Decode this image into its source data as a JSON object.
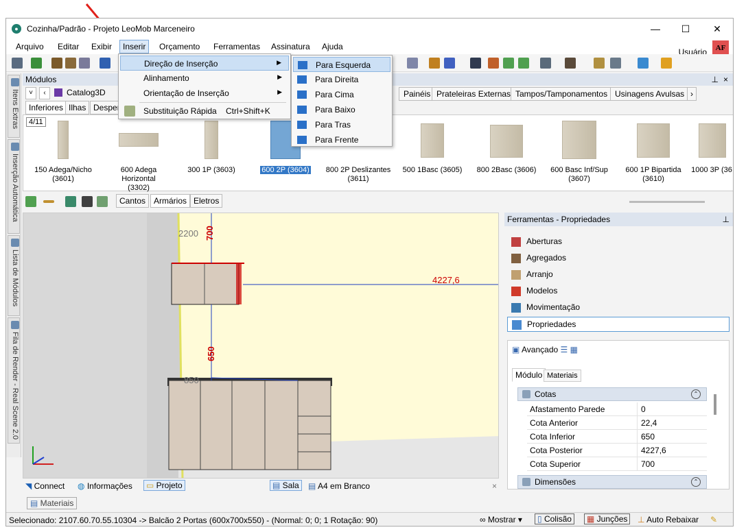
{
  "window": {
    "title": "Cozinha/Padrão - Projeto LeoMob Marceneiro",
    "controls": [
      "—",
      "☐",
      "✕"
    ]
  },
  "menu": {
    "items": [
      "Arquivo",
      "Editar",
      "Exibir",
      "Inserir",
      "Orçamento",
      "Ferramentas",
      "Assinatura",
      "Ajuda"
    ],
    "active": "Inserir"
  },
  "user": {
    "label": "Usuário",
    "avatar": "AF"
  },
  "inserir_menu": {
    "items": [
      {
        "label": "Direção de Inserção",
        "submenu": true
      },
      {
        "label": "Alinhamento",
        "submenu": true
      },
      {
        "label": "Orientação de Inserção",
        "submenu": true
      },
      {
        "label": "Substituição Rápida",
        "shortcut": "Ctrl+Shift+K"
      }
    ]
  },
  "direcao_submenu": {
    "items": [
      "Para Esquerda",
      "Para Direita",
      "Para Cima",
      "Para Baixo",
      "Para Tras",
      "Para Frente"
    ]
  },
  "left_tabs": [
    "Itens Extras",
    "Inserção Automática",
    "Lista de Módulos",
    "Fila de Render - Real Scene 2.0"
  ],
  "modules": {
    "header": "Módulos",
    "pin": "ᵖ",
    "close": "×",
    "catalog": "Catalog3D",
    "category_tabs": [
      "Painéis",
      "Prateleiras Externas",
      "Tampos/Tamponamentos",
      "Usinagens Avulsas"
    ],
    "sub_tabs": [
      "Inferiores",
      "Ilhas",
      "Despen"
    ],
    "counter": "4/11",
    "gallery": [
      {
        "line1": "150 Adega/Nicho",
        "line2": "(3601)"
      },
      {
        "line1": "600 Adega Horizontal",
        "line2": "(3302)"
      },
      {
        "line1": "300 1P (3603)",
        "line2": ""
      },
      {
        "line1": "600 2P (3604)",
        "line2": ""
      },
      {
        "line1": "800 2P Deslizantes",
        "line2": "(3611)"
      },
      {
        "line1": "500 1Basc (3605)",
        "line2": ""
      },
      {
        "line1": "800 2Basc (3606)",
        "line2": ""
      },
      {
        "line1": "600 Basc Inf/Sup",
        "line2": "(3607)"
      },
      {
        "line1": "600 1P Bipartida",
        "line2": "(3610)"
      },
      {
        "line1": "1000 3P (36",
        "line2": ""
      }
    ],
    "selected_index": 3
  },
  "view_tabs": [
    "Cantos",
    "Armários",
    "Eletros"
  ],
  "viewport": {
    "dims": [
      "2200",
      "700",
      "4227,6",
      "650",
      "850"
    ]
  },
  "bottom": {
    "connect": "Connect",
    "info": "Informações",
    "project": "Projeto",
    "sala": "Sala",
    "a4": "A4 em Branco",
    "close": "×"
  },
  "materiais_tab": "Materiais",
  "status": {
    "text": "Selecionado: 2107.60.70.55.10304 -> Balcão 2 Portas (600x700x550) - (Normal: 0; 0; 1 Rotação: 90)",
    "mostrar": "Mostrar",
    "colisao": "Colisão",
    "juncoes": "Junções",
    "auto": "Auto Rebaixar"
  },
  "tools_panel": {
    "header": "Ferramentas - Propriedades",
    "items": [
      "Aberturas",
      "Agregados",
      "Arranjo",
      "Modelos",
      "Movimentação",
      "Propriedades"
    ],
    "selected": "Propriedades",
    "advanced": "Avançado",
    "tabs": [
      "Módulo",
      "Materiais"
    ],
    "section_cotas": "Cotas",
    "section_dim": "Dimensões",
    "properties": [
      {
        "name": "Afastamento Parede",
        "value": "0"
      },
      {
        "name": "Cota Anterior",
        "value": "22,4"
      },
      {
        "name": "Cota Inferior",
        "value": "650"
      },
      {
        "name": "Cota Posterior",
        "value": "4227,6"
      },
      {
        "name": "Cota Superior",
        "value": "700"
      }
    ]
  },
  "colors": {
    "accent": "#3378c6",
    "highlight": "#cce0f5",
    "wall": "#fffbd6",
    "cabinet": "#d8cbbd",
    "dim_red": "#c00000",
    "dim_blue": "#1f3fbf"
  }
}
